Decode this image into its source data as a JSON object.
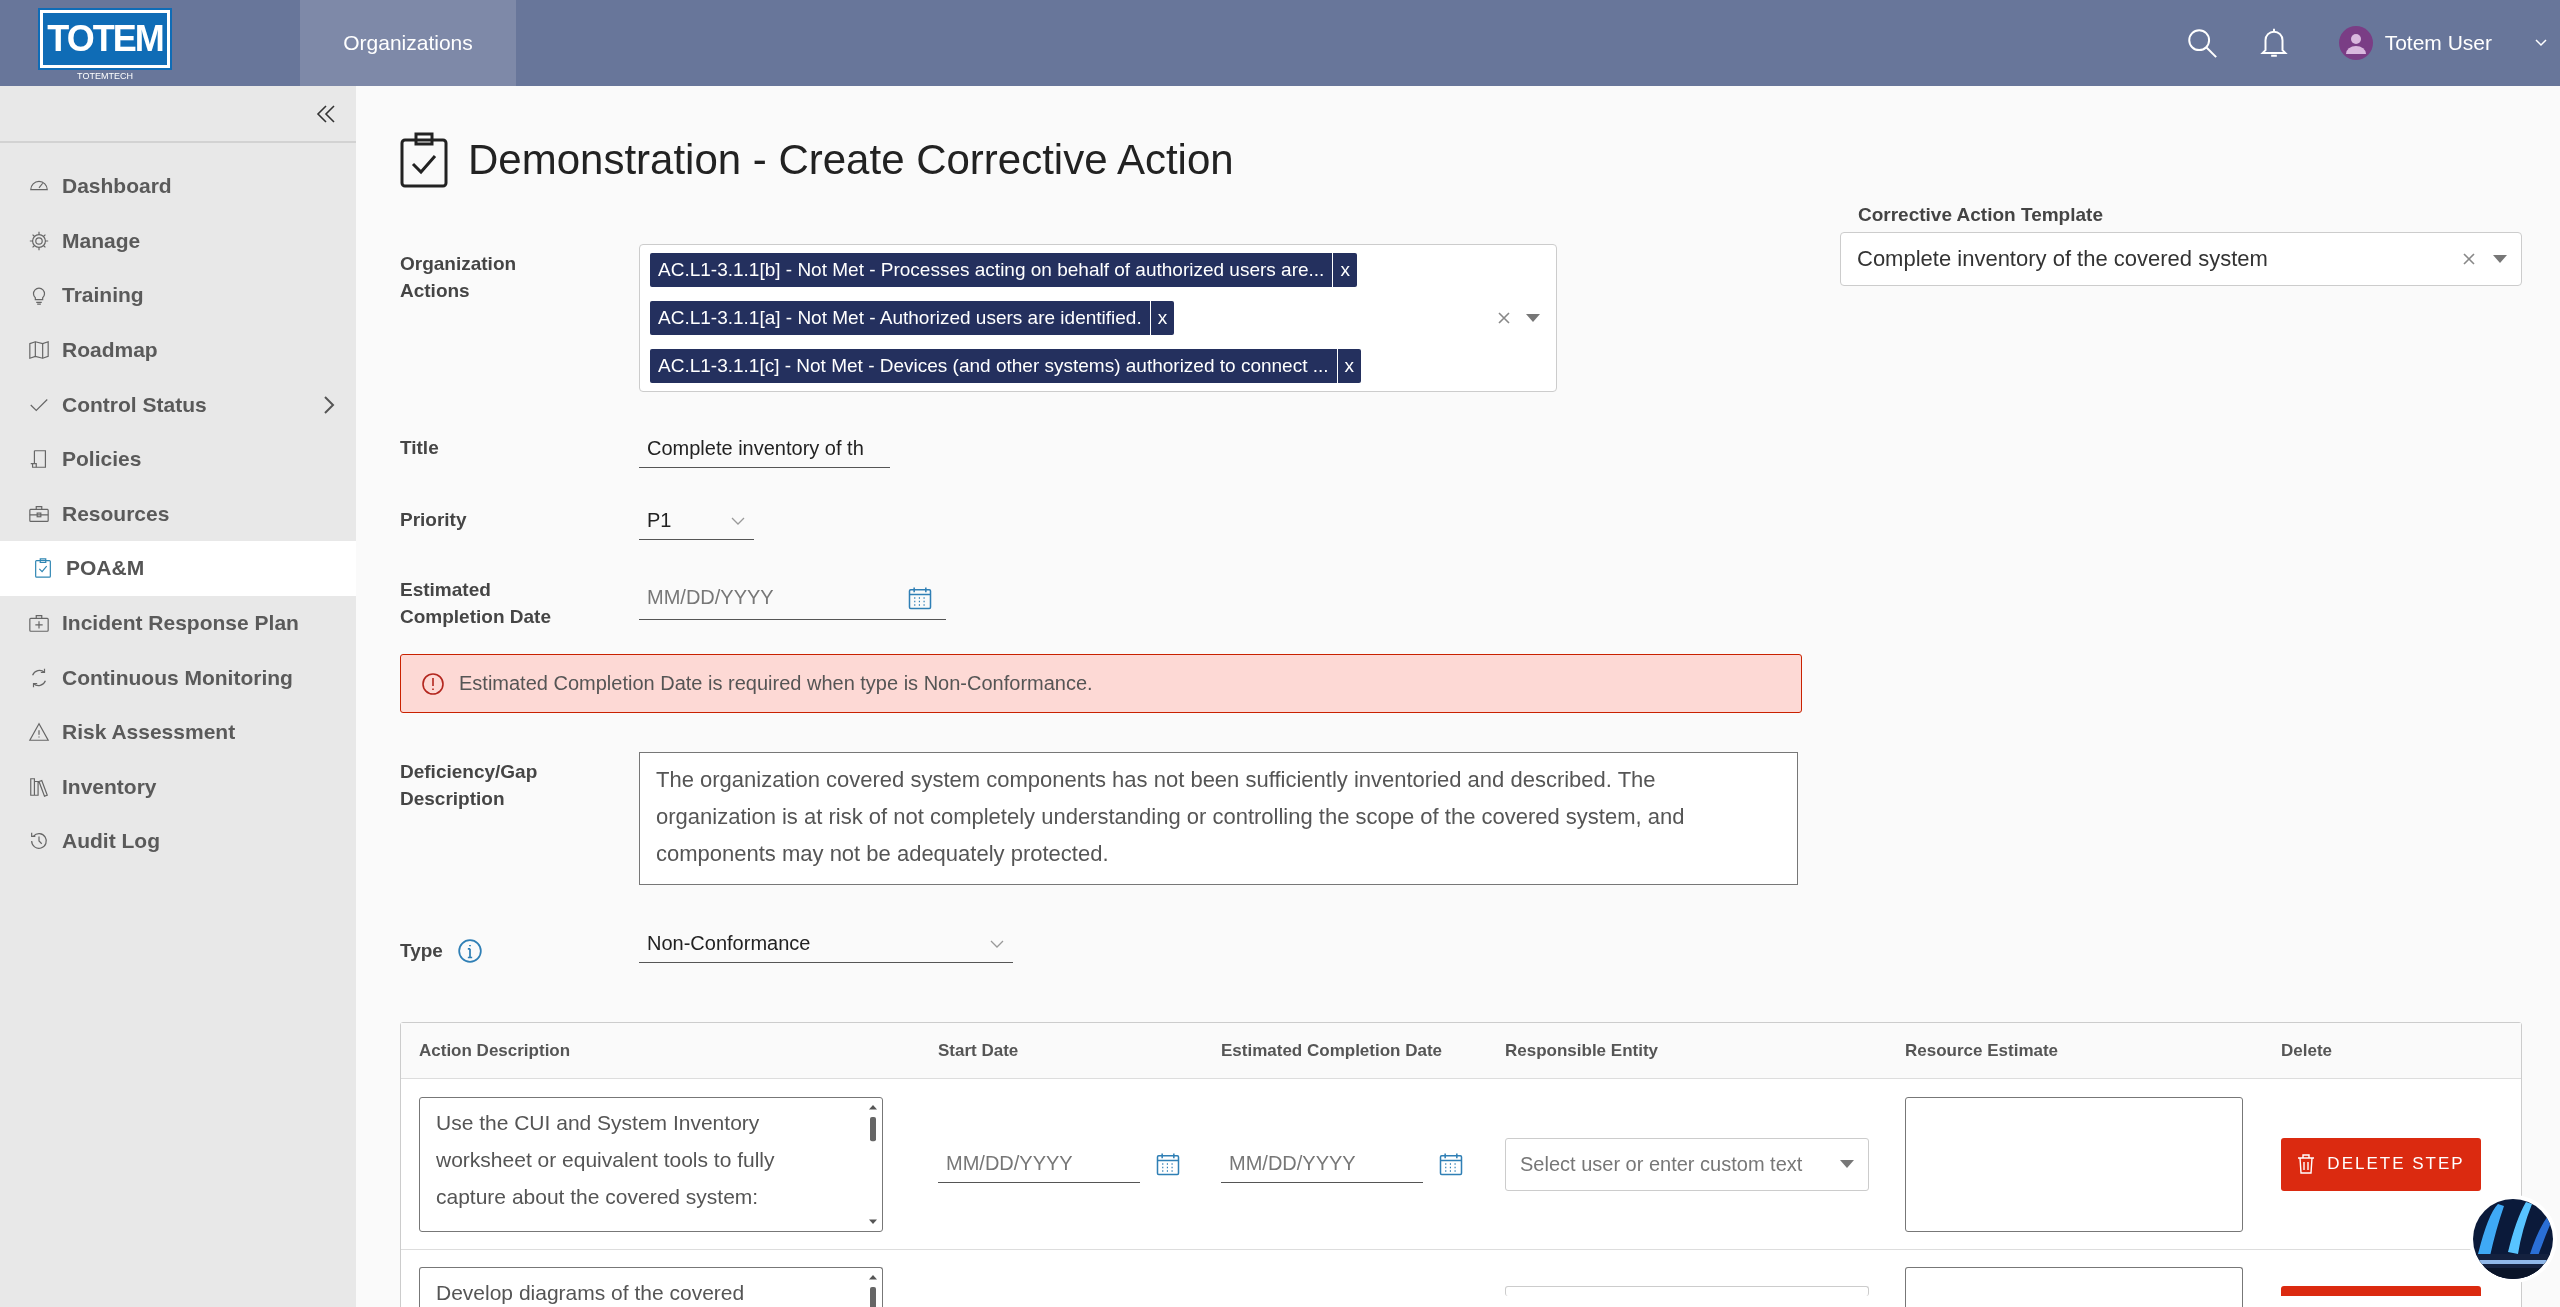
{
  "header": {
    "logo": "TOTEM",
    "logo_sub": "TOTEMTECH",
    "nav": [
      {
        "label": "Organizations",
        "selected": true
      }
    ],
    "user": "Totem User"
  },
  "sidebar": {
    "items": [
      {
        "label": "Dashboard",
        "selected": false,
        "expandable": false
      },
      {
        "label": "Manage",
        "selected": false,
        "expandable": false
      },
      {
        "label": "Training",
        "selected": false,
        "expandable": false
      },
      {
        "label": "Roadmap",
        "selected": false,
        "expandable": false
      },
      {
        "label": "Control Status",
        "selected": false,
        "expandable": true
      },
      {
        "label": "Policies",
        "selected": false,
        "expandable": false
      },
      {
        "label": "Resources",
        "selected": false,
        "expandable": false
      },
      {
        "label": "POA&M",
        "selected": true,
        "expandable": false
      },
      {
        "label": "Incident Response Plan",
        "selected": false,
        "expandable": false
      },
      {
        "label": "Continuous Monitoring",
        "selected": false,
        "expandable": false
      },
      {
        "label": "Risk Assessment",
        "selected": false,
        "expandable": false
      },
      {
        "label": "Inventory",
        "selected": false,
        "expandable": false
      },
      {
        "label": "Audit Log",
        "selected": false,
        "expandable": false
      }
    ]
  },
  "page": {
    "title": "Demonstration - Create Corrective Action"
  },
  "form": {
    "organization_actions": {
      "label": "Organization Actions",
      "tags": [
        {
          "text": "AC.L1-3.1.1[b] - Not Met - Processes acting on behalf of authorized users are...",
          "remove": "x"
        },
        {
          "text": "AC.L1-3.1.1[a] - Not Met - Authorized users are identified.",
          "remove": "x"
        },
        {
          "text": "AC.L1-3.1.1[c] - Not Met - Devices (and other systems) authorized to connect ...",
          "remove": "x"
        }
      ]
    },
    "title": {
      "label": "Title",
      "value": "Complete inventory of th"
    },
    "priority": {
      "label": "Priority",
      "value": "P1"
    },
    "estimated_completion_date": {
      "label": "Estimated Completion Date",
      "placeholder": "MM/DD/YYYY"
    },
    "error": "Estimated Completion Date is required when type is Non-Conformance.",
    "deficiency": {
      "label": "Deficiency/Gap Description",
      "value": "The organization covered system components has not been sufficiently inventoried and described. The organization is at risk of not completely understanding or controlling the scope of the covered system, and components may not be adequately protected."
    },
    "type": {
      "label": "Type",
      "value": "Non-Conformance"
    }
  },
  "template": {
    "label": "Corrective Action Template",
    "value": "Complete inventory of the covered system"
  },
  "steps": {
    "columns": [
      "Action Description",
      "Start Date",
      "Estimated Completion Date",
      "Responsible Entity",
      "Resource Estimate",
      "Delete"
    ],
    "rows": [
      {
        "action": "Use the CUI and System Inventory worksheet or equivalent tools to fully capture about the covered system:",
        "start_placeholder": "MM/DD/YYYY",
        "end_placeholder": "MM/DD/YYYY",
        "responsible_placeholder": "Select user or enter custom text",
        "delete_label": "DELETE STEP"
      },
      {
        "action": "Develop diagrams of the covered"
      }
    ]
  }
}
